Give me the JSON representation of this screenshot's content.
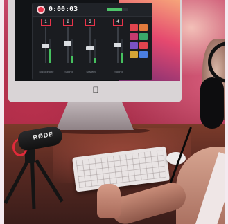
{
  "scene": {
    "microphone": {
      "brand": "RØDE"
    },
    "monitor_app": {
      "timer": "0:00:03",
      "meter_level": 0.7,
      "channels": [
        {
          "badge": "1",
          "label": "Microphone",
          "fader": 0.45,
          "level": 0.6
        },
        {
          "badge": "2",
          "label": "Sound",
          "fader": 0.55,
          "level": 0.3
        },
        {
          "badge": "3",
          "label": "System",
          "fader": 0.4,
          "level": 0.2
        },
        {
          "badge": "4",
          "label": "Sound",
          "fader": 0.5,
          "level": 0.4
        }
      ],
      "pad_colors": [
        "#e2444e",
        "#e27a3c",
        "#c63a6e",
        "#3aa86a",
        "#7a52c4",
        "#e2444e",
        "#d3a436",
        "#4a7ee0"
      ]
    },
    "accent_colors": {
      "mic_shock_mount": "#e02a3a",
      "record_button": "#e8344a",
      "level_green": "#46c15f"
    }
  }
}
